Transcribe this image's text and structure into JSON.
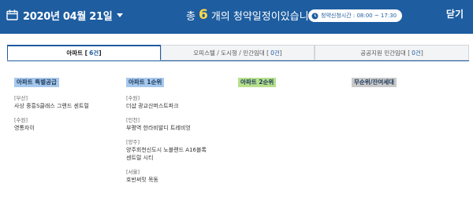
{
  "header": {
    "date": "2020년 04월 21일",
    "summary_prefix": "총",
    "summary_count": "6",
    "summary_suffix": "개의 청약일정이있습니다.",
    "time_label": "청약신청시간 : 08:00 ~ 17:30",
    "close_label": "닫기",
    "bar_color": "#1d5da0"
  },
  "tabs": [
    {
      "label": "아파트 [",
      "count": "6건",
      "close": "]",
      "active": true
    },
    {
      "label": "오피스텔 / 도시형 / 민간임대 [",
      "count": "0건",
      "close": "]",
      "active": false
    },
    {
      "label": "공공지원 민간임대 [",
      "count": "0건",
      "close": "]",
      "active": false
    }
  ],
  "columns": [
    {
      "title": "아파트 특별공급",
      "color": "#a6c8ec",
      "groups": [
        {
          "region": "[부산]",
          "items": [
            "사상 중흥S클래스 그랜드 센트럴"
          ]
        },
        {
          "region": "[수원]",
          "items": [
            "영통자이"
          ]
        }
      ]
    },
    {
      "title": "아파트 1순위",
      "color": "#a6c8ec",
      "groups": [
        {
          "region": "[수원]",
          "items": [
            "더샵 광교산퍼스트파크"
          ]
        },
        {
          "region": "[인천]",
          "items": [
            "부평역 한라비발디 트레비엉"
          ]
        },
        {
          "region": "[양주]",
          "items": [
            "양주회천신도시 노블랜드 A16블록",
            "센트럴 시티"
          ]
        },
        {
          "region": "[서울]",
          "items": [
            "호반써밋 목동"
          ]
        }
      ]
    },
    {
      "title": "아파트 2순위",
      "color": "#b6e08c",
      "groups": []
    },
    {
      "title": "무순위/잔여세대",
      "color": "#c9c9c9",
      "groups": []
    }
  ]
}
